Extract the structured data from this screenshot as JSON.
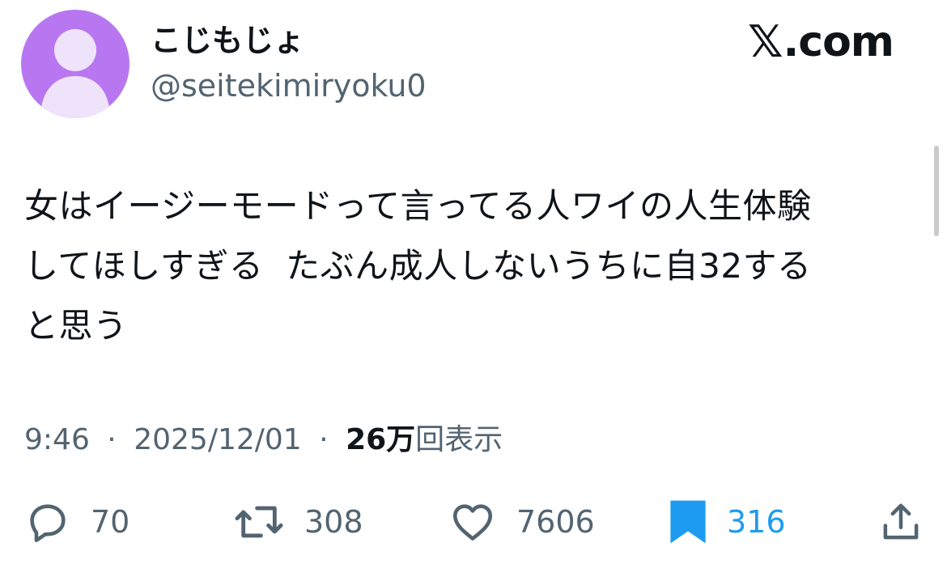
{
  "brand": {
    "x_glyph": "𝕏",
    "domain": ".com"
  },
  "user": {
    "display_name": "こじもじょ",
    "handle": "@seitekimiryoku0",
    "avatar_color": "#b877f0",
    "avatar_icon": "default-profile-icon"
  },
  "tweet": {
    "text": "女はイージーモードって言ってる人ワイの人生体験\nしてほしすぎる  たぶん成人しないうちに自32する\nと思う",
    "time": "9:46",
    "separator": "·",
    "date": "2025/12/01",
    "views_count": "26万",
    "views_label": "回表示"
  },
  "actions": {
    "reply": {
      "icon": "reply-icon",
      "count": "70"
    },
    "retweet": {
      "icon": "retweet-icon",
      "count": "308"
    },
    "like": {
      "icon": "heart-icon",
      "count": "7606"
    },
    "bookmark": {
      "icon": "bookmark-icon",
      "count": "316",
      "active_color": "#1d9bf0"
    },
    "share": {
      "icon": "share-icon"
    }
  }
}
